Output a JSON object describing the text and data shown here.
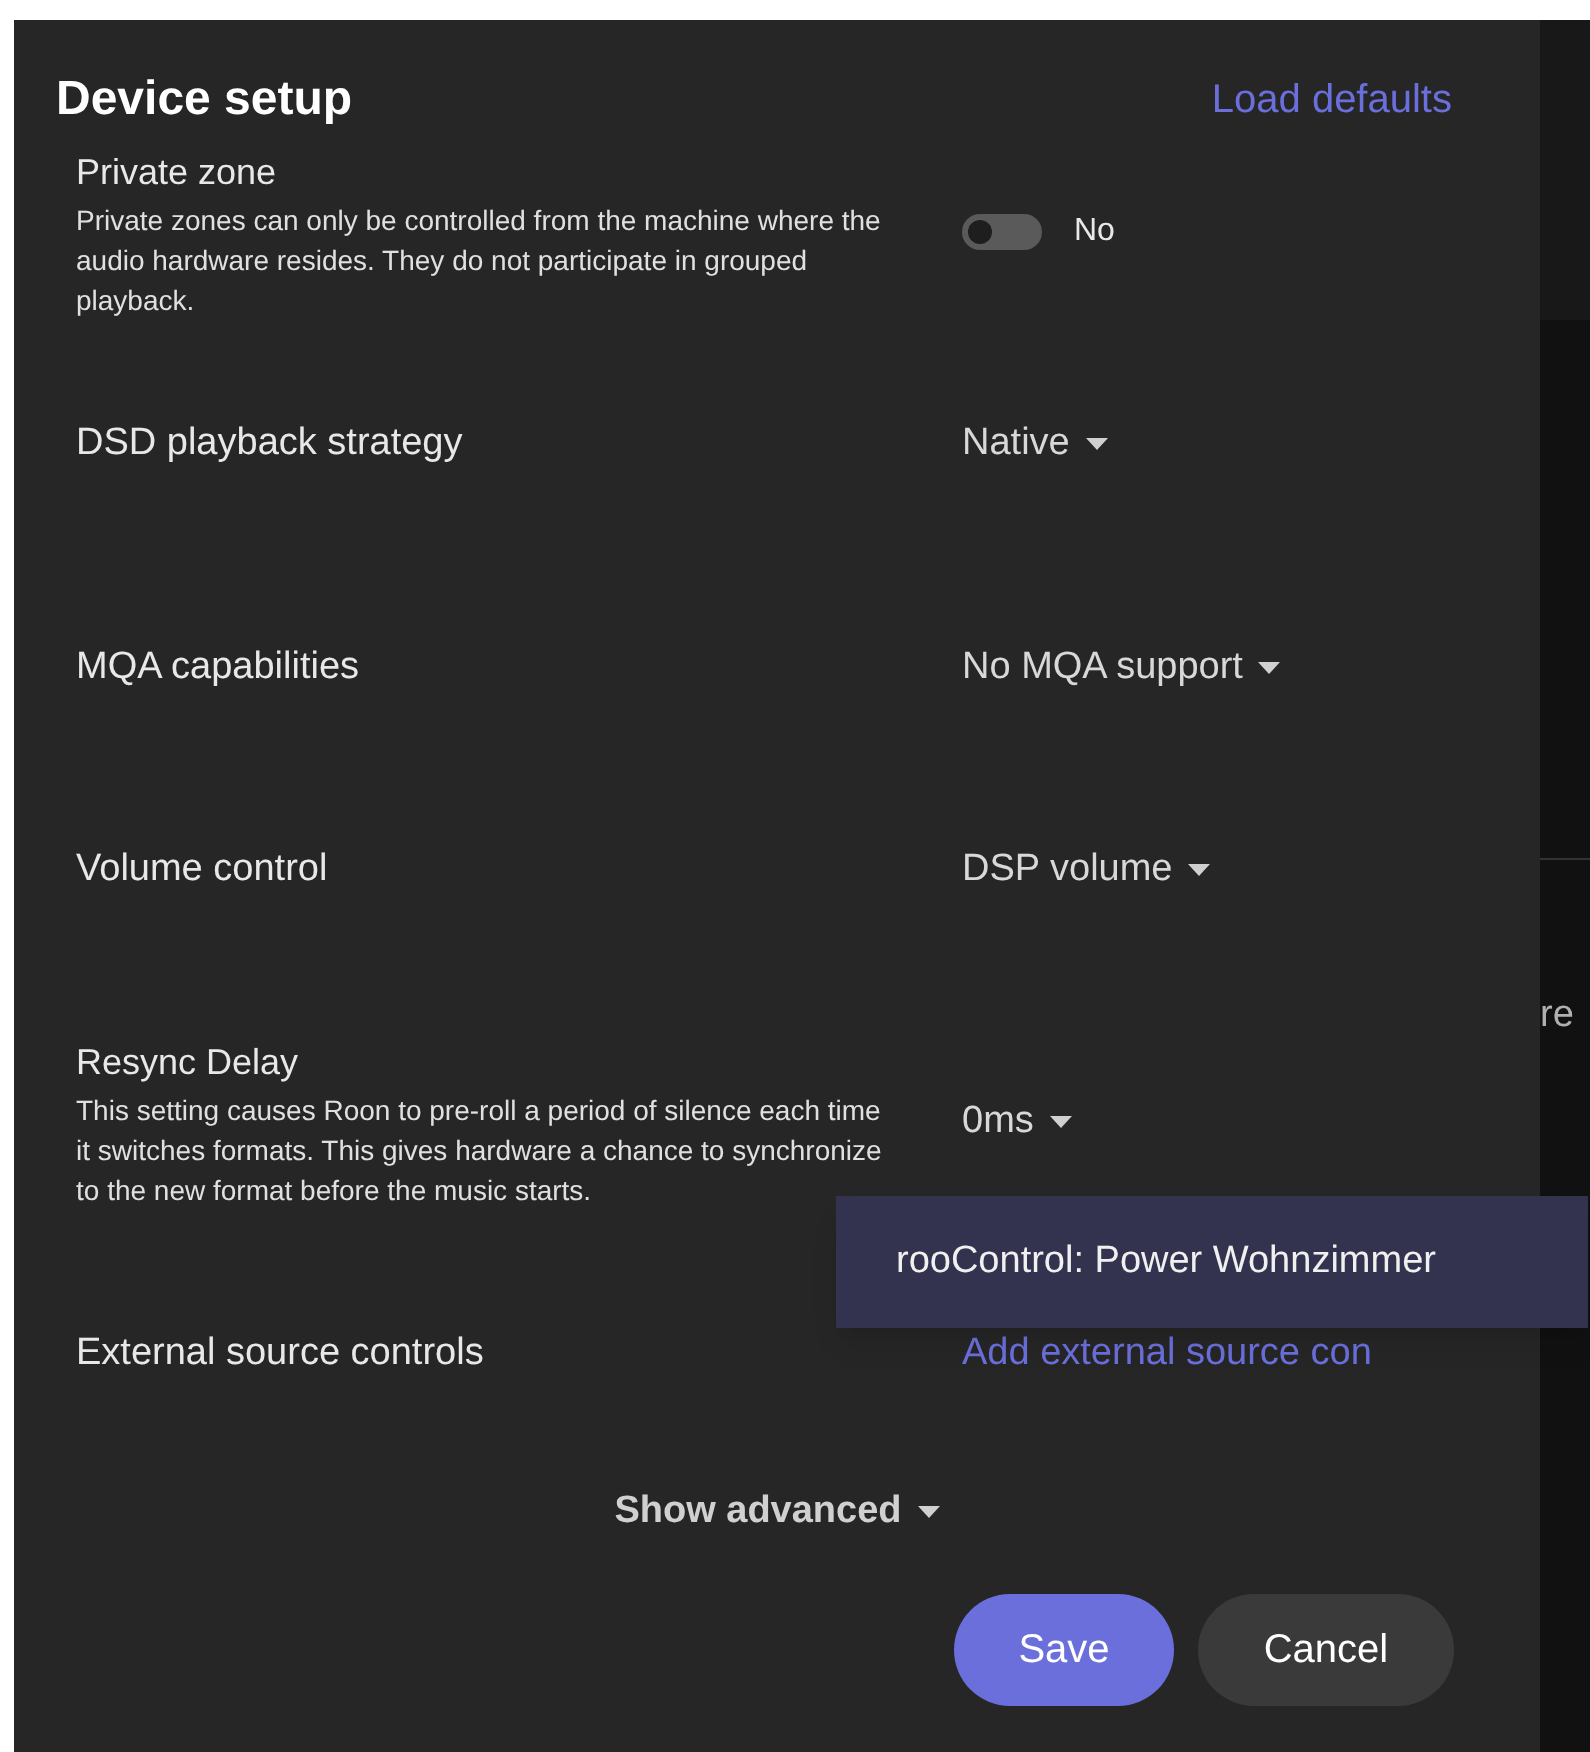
{
  "background": {
    "text": "re"
  },
  "dialog": {
    "title": "Device setup",
    "load_defaults": "Load defaults",
    "settings": [
      {
        "kind": "toggle",
        "label": "Private zone",
        "description": "Private zones can only be controlled from the machine where the audio hardware resides. They do not participate in grouped playback.",
        "on": false,
        "value": "No"
      },
      {
        "kind": "dropdown",
        "label": "DSD playback strategy",
        "value": "Native"
      },
      {
        "kind": "dropdown",
        "label": "MQA capabilities",
        "value": "No MQA support"
      },
      {
        "kind": "dropdown",
        "label": "Volume control",
        "value": "DSP volume"
      },
      {
        "kind": "dropdown",
        "label": "Resync Delay",
        "description": "This setting causes Roon to pre-roll a period of silence each time it switches formats. This gives hardware a chance to synchronize to the new format before the music starts.",
        "value": "0ms"
      },
      {
        "kind": "link",
        "label": "External source controls",
        "value": "Add external source con"
      }
    ],
    "show_advanced": "Show advanced",
    "buttons": [
      {
        "kind": "primary",
        "label": "Save"
      },
      {
        "kind": "secondary",
        "label": "Cancel"
      }
    ]
  },
  "popup_menu": {
    "items": [
      "rooControl: Power Wohnzimmer"
    ]
  }
}
